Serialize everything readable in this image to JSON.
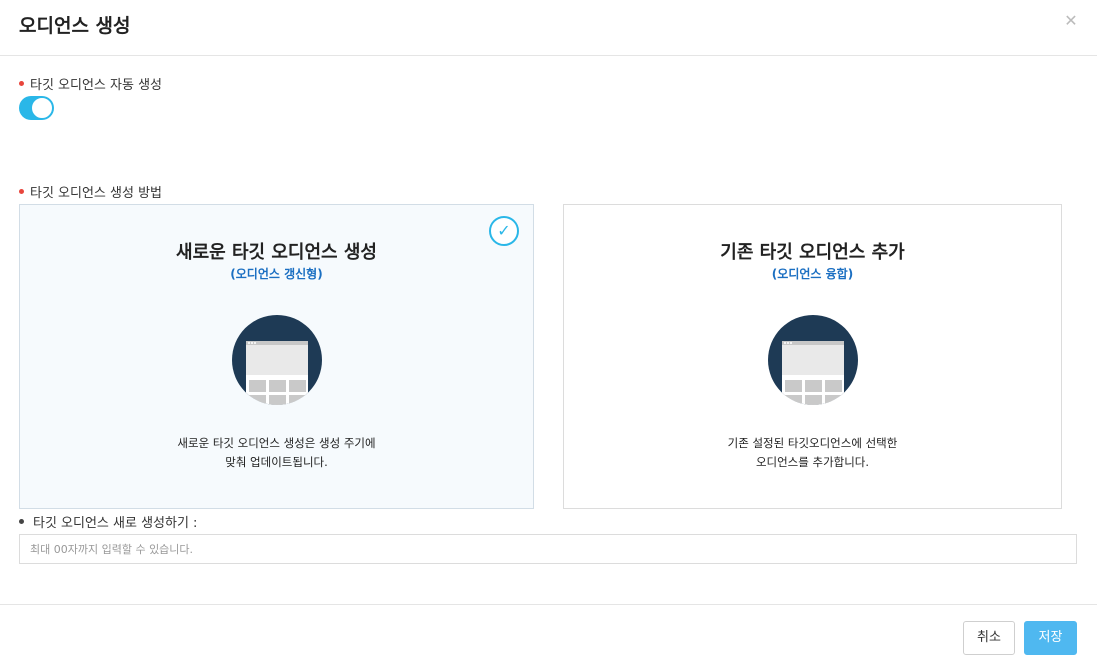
{
  "dialog": {
    "title": "오디언스 생성",
    "close_icon": "close-icon"
  },
  "auto_create": {
    "label": "타깃 오디언스 자동 생성",
    "toggle_on": true
  },
  "method": {
    "label": "타깃 오디언스 생성 방법",
    "options": [
      {
        "title": "새로운 타깃 오디언스 생성",
        "subtitle": "(오디언스 갱신형)",
        "desc_line1": "새로운 타깃 오디언스 생성은 생성 주기에",
        "desc_line2": "맞춰 업데이트됩니다.",
        "selected": true
      },
      {
        "title": "기존 타깃 오디언스 추가",
        "subtitle": "(오디언스 융합)",
        "desc_line1": "기존 설정된 타깃오디언스에 선택한",
        "desc_line2": "오디언스를 추가합니다.",
        "selected": false
      }
    ]
  },
  "new_audience": {
    "label": "타깃 오디언스 새로 생성하기 :",
    "placeholder": "최대 00자까지 입력할 수 있습니다."
  },
  "footer": {
    "cancel_label": "취소",
    "save_label": "저장"
  },
  "colors": {
    "accent": "#2ab7e8",
    "required_dot": "#e8453c",
    "subtitle_blue": "#1b6fc2",
    "save_button": "#4fb8f0"
  }
}
